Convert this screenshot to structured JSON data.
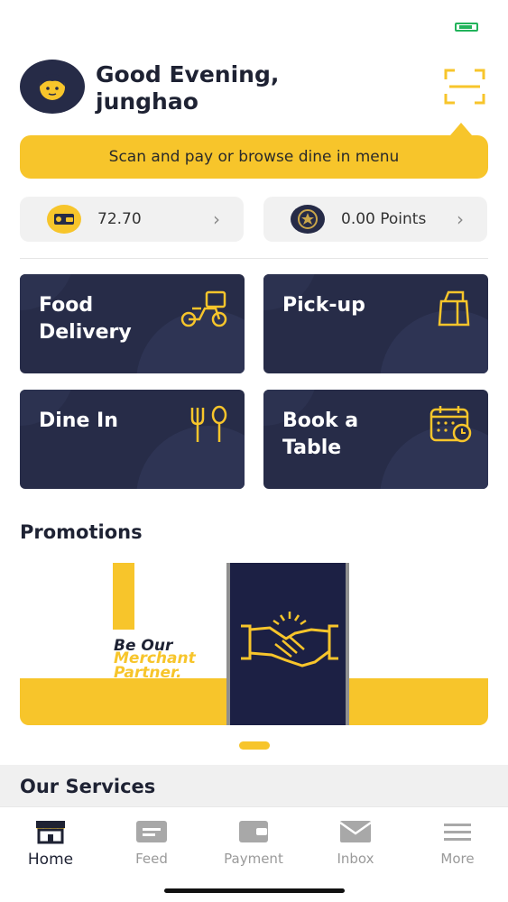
{
  "header": {
    "greeting_line1": "Good Evening,",
    "greeting_line2": "junghao",
    "scan_banner": "Scan and pay or browse dine in menu"
  },
  "wallet": {
    "balance": "72.70",
    "points": "0.00 Points",
    "chevron": "›"
  },
  "tiles": [
    {
      "label": "Food\nDelivery",
      "icon": "scooter-icon"
    },
    {
      "label": "Pick-up",
      "icon": "bag-icon"
    },
    {
      "label": "Dine In",
      "icon": "fork-spoon-icon"
    },
    {
      "label": "Book a\nTable",
      "icon": "calendar-icon"
    }
  ],
  "promotions": {
    "title": "Promotions",
    "banner_line1": "Be Our",
    "banner_line2": "Merchant",
    "banner_line3": "Partner."
  },
  "services": {
    "title": "Our Services"
  },
  "tabbar": {
    "items": [
      {
        "label": "Home",
        "icon": "store-icon",
        "active": true
      },
      {
        "label": "Feed",
        "icon": "feed-icon",
        "active": false
      },
      {
        "label": "Payment",
        "icon": "wallet-icon",
        "active": false
      },
      {
        "label": "Inbox",
        "icon": "mail-icon",
        "active": false
      },
      {
        "label": "More",
        "icon": "menu-icon",
        "active": false
      }
    ]
  },
  "colors": {
    "accent": "#f7c52b",
    "tile_bg": "#272c48",
    "text_dark": "#1e2233"
  }
}
